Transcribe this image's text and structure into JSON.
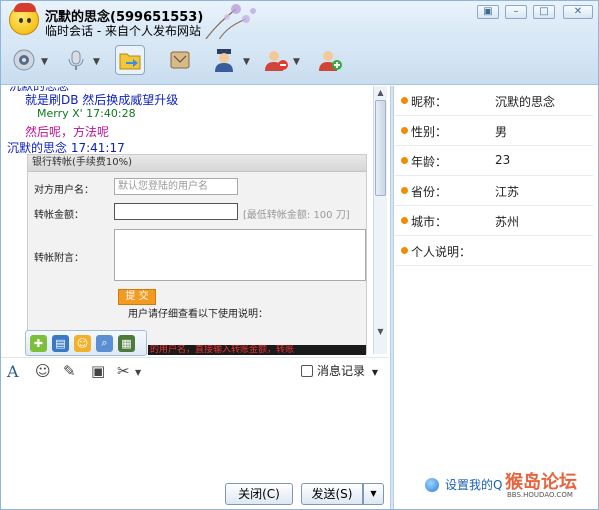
{
  "window": {
    "contact_name": "沉默的思念(599651553)",
    "subtitle": "临时会话 - 来自个人发布网站",
    "controls": [
      "▣",
      "–",
      "□",
      "✕"
    ]
  },
  "toolbar": {
    "items": [
      "video-call",
      "voice-call",
      "send-file",
      "app-box",
      "remote-assist",
      "add-contact",
      "contact-card"
    ]
  },
  "chat": {
    "partial_top": "沉默的思念",
    "messages": [
      {
        "text": "就是刷DB  然后换成威望升级",
        "color": "#0a1fbf"
      },
      {
        "text": "Merry X'   17:40:28",
        "color": "#0a7a1f"
      },
      {
        "text": "然后呢，方法呢",
        "color": "#c0128f"
      },
      {
        "text": "沉默的思念  17:41:17",
        "color": "#0a1fbf"
      }
    ]
  },
  "form": {
    "header": "银行转帐(手续费10%)",
    "payee_label": "对方用户名：",
    "payee_placeholder": "默认您登陆的用户名",
    "amount_label": "转帐金额：",
    "amount_hint": "[最低转帐金额: 100 刀]",
    "note_label": "转帐附言：",
    "submit": "提 交",
    "usage_note": "用户请仔细查看以下使用说明：",
    "black_text": "的用户名，直接输入转账金额，转账"
  },
  "input_toolbar": {
    "font": "A",
    "history_label": "消息记录"
  },
  "buttons": {
    "close": "关闭(C)",
    "send": "发送(S)",
    "send_arrow": "▼"
  },
  "profile": {
    "rows": [
      {
        "label": "昵称：",
        "value": "沉默的思念"
      },
      {
        "label": "性别：",
        "value": "男"
      },
      {
        "label": "年龄：",
        "value": "23"
      },
      {
        "label": "省份：",
        "value": "江苏"
      },
      {
        "label": "城市：",
        "value": "苏州"
      },
      {
        "label": "个人说明：",
        "value": ""
      }
    ],
    "set_q_link": "设置我的Q",
    "watermark": "猴岛论坛",
    "watermark_sub": "BBS.HOUDAO.COM"
  },
  "colors": {
    "accent": "#1a5fb4",
    "dot": "#f08c00",
    "submit": "#f39a21"
  }
}
